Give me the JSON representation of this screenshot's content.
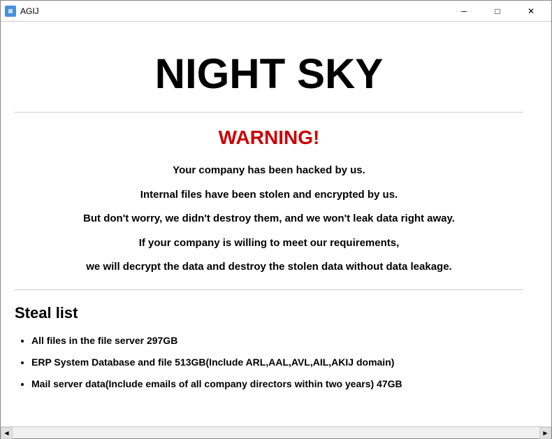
{
  "window": {
    "title": "AGIJ",
    "main_title": "NIGHT SKY",
    "warning_heading": "WARNING!",
    "paragraphs": [
      "Your company has been hacked by us.",
      "Internal files have been stolen and encrypted by us.",
      "But don't worry, we didn't destroy them, and we won't leak data right away.",
      "If your company is willing to meet our requirements,",
      "we will decrypt the data and destroy the stolen data without data leakage."
    ],
    "steal_list_heading": "Steal list",
    "steal_items": [
      "All files in the file server  297GB",
      "ERP System Database and file  513GB(Include ARL,AAL,AVL,AIL,AKIJ domain)",
      "Mail server data(Include emails of all company directors within two years)  47GB"
    ],
    "controls": {
      "minimize": "─",
      "maximize": "□",
      "close": "✕"
    }
  }
}
